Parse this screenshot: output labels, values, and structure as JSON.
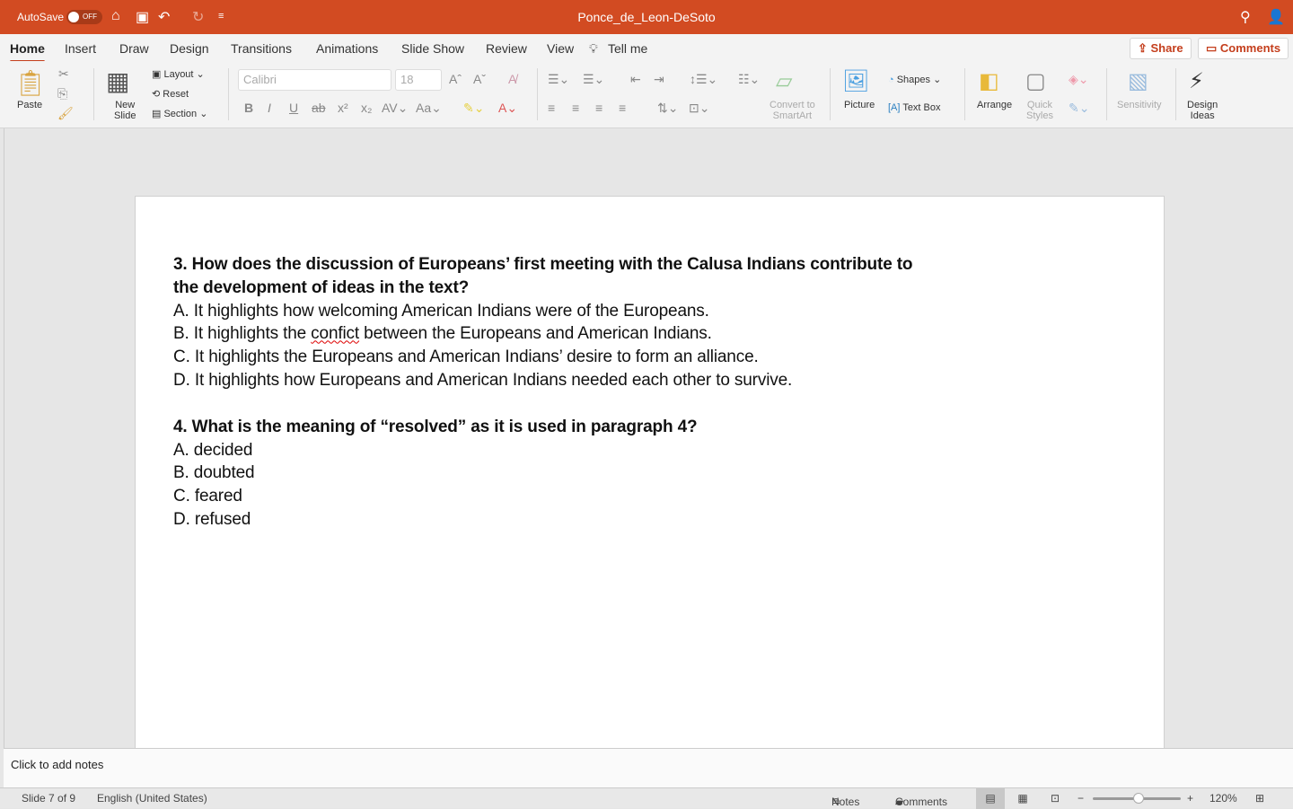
{
  "titlebar": {
    "autosave": "AutoSave",
    "toggle": "OFF",
    "doc_title": "Ponce_de_Leon-DeSoto"
  },
  "tabs": [
    "Home",
    "Insert",
    "Draw",
    "Design",
    "Transitions",
    "Animations",
    "Slide Show",
    "Review",
    "View",
    "Tell me"
  ],
  "actions": {
    "share": "Share",
    "comments": "Comments"
  },
  "ribbon": {
    "paste": "Paste",
    "new_slide_1": "New",
    "new_slide_2": "Slide",
    "layout": "Layout",
    "reset": "Reset",
    "section": "Section",
    "font": "Calibri",
    "size": "18",
    "convert_1": "Convert to",
    "convert_2": "SmartArt",
    "picture": "Picture",
    "shapes": "Shapes",
    "text_box": "Text Box",
    "arrange": "Arrange",
    "quick_1": "Quick",
    "quick_2": "Styles",
    "sensitivity": "Sensitivity",
    "design_1": "Design",
    "design_2": "Ideas"
  },
  "slide": {
    "q3_line1": "3. How does the discussion of Europeans’ first meeting with the Calusa Indians contribute to",
    "q3_line2": "the development of ideas in the text?",
    "q3_a": "A. It highlights how welcoming American Indians were of the Europeans.",
    "q3_b_pre": "B. It highlights the ",
    "q3_b_word": "confict",
    "q3_b_post": " between the Europeans and American Indians.",
    "q3_c": "C. It highlights the Europeans and American Indians’ desire to form an alliance.",
    "q3_d": "D. It highlights how Europeans and American Indians needed each other to survive.",
    "q4": "4. What is the meaning of “resolved” as it is used in paragraph 4?",
    "q4_a": "A. decided",
    "q4_b": "B. doubted",
    "q4_c": "C. feared",
    "q4_d": "D. refused"
  },
  "notes": "Click to add notes",
  "status": {
    "slide": "Slide 7 of 9",
    "language": "English (United States)",
    "notes": "Notes",
    "comments": "Comments",
    "zoom": "120%",
    "zoom_slider_fraction": 0.52
  },
  "colors": {
    "brand": "#d24b22",
    "accent": "#c43e1c"
  }
}
